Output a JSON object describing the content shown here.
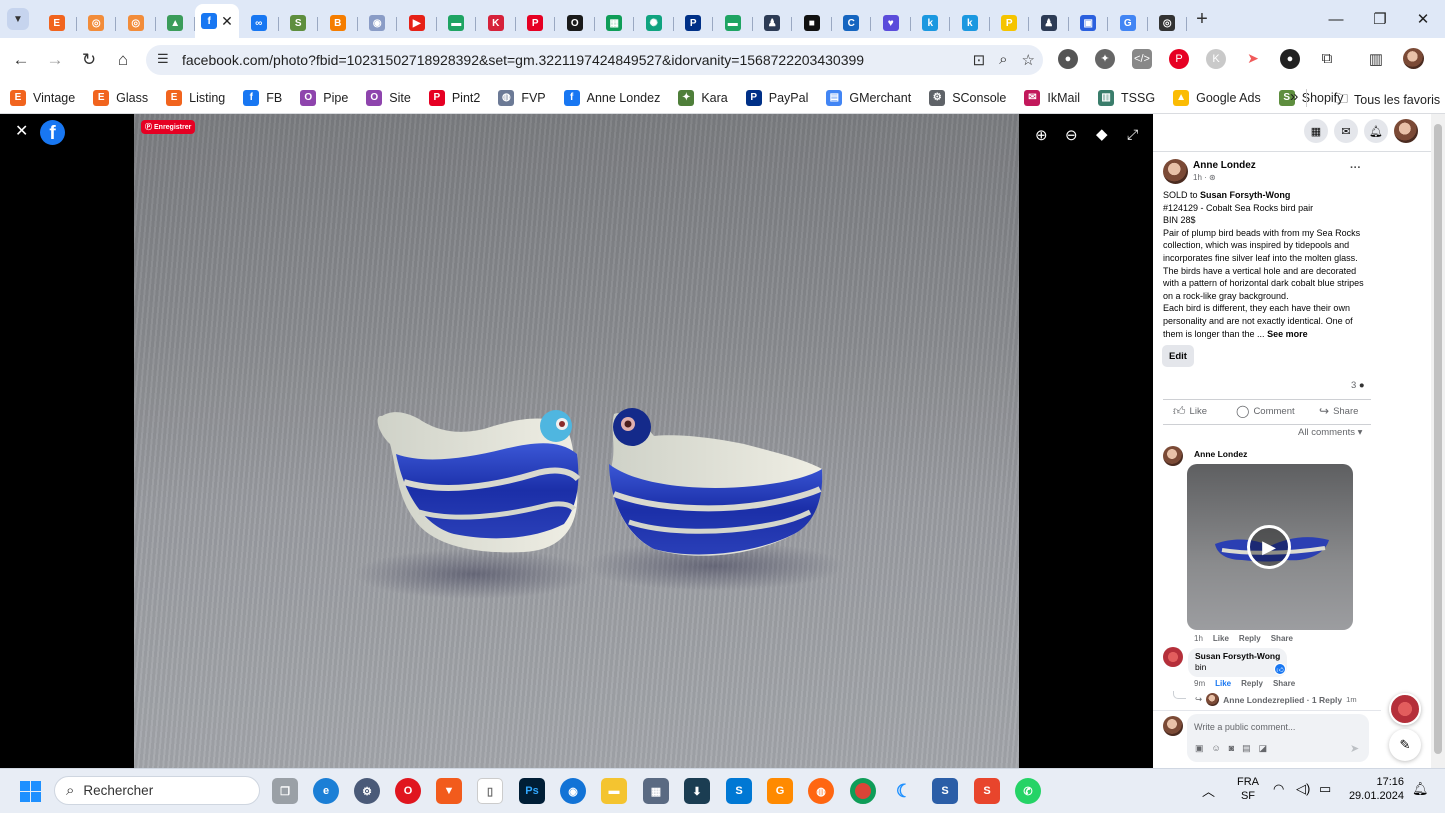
{
  "browser": {
    "url": "facebook.com/photo?fbid=10231502718928392&set=gm.3221197424849527&idorvanity=1568722203430399",
    "tab_close": "✕",
    "new_tab": "+",
    "tabs": [
      {
        "icon": "etsy-icon",
        "color": "#f1641e",
        "glyph": "E"
      },
      {
        "icon": "orange-circle-icon",
        "color": "#f28c3a",
        "glyph": "◎"
      },
      {
        "icon": "orange-circle-icon",
        "color": "#f28c3a",
        "glyph": "◎"
      },
      {
        "icon": "triangle-app-icon",
        "color": "#3b9c5a",
        "glyph": "▲"
      },
      {
        "icon": "facebook-icon",
        "color": "#1877f2",
        "glyph": "f"
      },
      {
        "icon": "meta-icon",
        "color": "#1877f2",
        "glyph": "∞"
      },
      {
        "icon": "shopify-icon",
        "color": "#5e8e3e",
        "glyph": "S"
      },
      {
        "icon": "blogger-icon",
        "color": "#f57d00",
        "glyph": "B"
      },
      {
        "icon": "gray-circle-icon",
        "color": "#8a9cc6",
        "glyph": "◉"
      },
      {
        "icon": "youtube-icon",
        "color": "#e62117",
        "glyph": "▶"
      },
      {
        "icon": "green-chat-icon",
        "color": "#1fa463",
        "glyph": "▬"
      },
      {
        "icon": "red-k-icon",
        "color": "#d6213a",
        "glyph": "K"
      },
      {
        "icon": "pinterest-icon",
        "color": "#e60023",
        "glyph": "P"
      },
      {
        "icon": "black-ring-icon",
        "color": "#1a1a1a",
        "glyph": "O"
      },
      {
        "icon": "green-grid-icon",
        "color": "#0f9d58",
        "glyph": "▦"
      },
      {
        "icon": "chatgpt-icon",
        "color": "#10a37f",
        "glyph": "✺"
      },
      {
        "icon": "paypal-icon",
        "color": "#003087",
        "glyph": "P"
      },
      {
        "icon": "green-chat-icon",
        "color": "#1fa463",
        "glyph": "▬"
      },
      {
        "icon": "person-icon",
        "color": "#2d3b55",
        "glyph": "♟"
      },
      {
        "icon": "black-box-icon",
        "color": "#111111",
        "glyph": "■"
      },
      {
        "icon": "blue-c-icon",
        "color": "#1565c0",
        "glyph": "C"
      },
      {
        "icon": "heart-icon",
        "color": "#5b4cdb",
        "glyph": "♥"
      },
      {
        "icon": "k-icon",
        "color": "#1b98e0",
        "glyph": "k"
      },
      {
        "icon": "k-icon",
        "color": "#1b98e0",
        "glyph": "k"
      },
      {
        "icon": "yellow-p-icon",
        "color": "#f5c400",
        "glyph": "P"
      },
      {
        "icon": "person-icon",
        "color": "#2d3b55",
        "glyph": "♟"
      },
      {
        "icon": "blue-box-icon",
        "color": "#2b60de",
        "glyph": "▣"
      },
      {
        "icon": "google-icon",
        "color": "#4285f4",
        "glyph": "G"
      },
      {
        "icon": "dark-circle-icon",
        "color": "#333333",
        "glyph": "◎"
      }
    ]
  },
  "bookmarks": [
    {
      "label": "Vintage",
      "icon": "etsy-icon",
      "color": "#f1641e",
      "glyph": "E"
    },
    {
      "label": "Glass",
      "icon": "etsy-icon",
      "color": "#f1641e",
      "glyph": "E"
    },
    {
      "label": "Listing",
      "icon": "etsy-icon",
      "color": "#f1641e",
      "glyph": "E"
    },
    {
      "label": "FB",
      "icon": "facebook-icon",
      "color": "#1877f2",
      "glyph": "f"
    },
    {
      "label": "Pipe",
      "icon": "purple-ring-icon",
      "color": "#8e44ad",
      "glyph": "O"
    },
    {
      "label": "Site",
      "icon": "purple-ring-icon",
      "color": "#8e44ad",
      "glyph": "O"
    },
    {
      "label": "Pint2",
      "icon": "pinterest-icon",
      "color": "#e60023",
      "glyph": "P"
    },
    {
      "label": "FVP",
      "icon": "fvp-icon",
      "color": "#6c7a96",
      "glyph": "◍"
    },
    {
      "label": "Anne Londez",
      "icon": "facebook-icon",
      "color": "#1877f2",
      "glyph": "f"
    },
    {
      "label": "Kara",
      "icon": "turtle-icon",
      "color": "#4f7f3a",
      "glyph": "✦"
    },
    {
      "label": "PayPal",
      "icon": "paypal-icon",
      "color": "#003087",
      "glyph": "P"
    },
    {
      "label": "GMerchant",
      "icon": "merchant-icon",
      "color": "#4285f4",
      "glyph": "▤"
    },
    {
      "label": "SConsole",
      "icon": "search-console-icon",
      "color": "#5f6368",
      "glyph": "⚙"
    },
    {
      "label": "IkMail",
      "icon": "mail-icon",
      "color": "#c2185b",
      "glyph": "✉"
    },
    {
      "label": "TSSG",
      "icon": "tssg-icon",
      "color": "#3a7d6b",
      "glyph": "▥"
    },
    {
      "label": "Google Ads",
      "icon": "google-ads-icon",
      "color": "#fbbc04",
      "glyph": "▲"
    },
    {
      "label": "Shopify",
      "icon": "shopify-icon",
      "color": "#5e8e3e",
      "glyph": "S"
    }
  ],
  "bookmarks_more": "»",
  "bookmarks_all": "Tous les favoris",
  "photo_viewer": {
    "close": "✕",
    "save_badge": "Enregistrer"
  },
  "post": {
    "author": "Anne Londez",
    "time": "1h · ",
    "more": "···",
    "line1_prefix": "SOLD to ",
    "line1_name": "Susan Forsyth-Wong",
    "line2": "#124129 - Cobalt Sea Rocks bird pair",
    "line3": "BIN 28$",
    "body1": "Pair of plump bird beads with from my Sea Rocks collection, which was inspired by tidepools and incorporates fine silver leaf into the molten glass. The birds have a vertical hole and are decorated with a pattern of horizontal dark cobalt blue stripes on a rock-like gray background.",
    "body2": "Each bird is different, they each have their own personality and are not exactly identical. One of them is longer than the ... ",
    "see_more": "See more",
    "edit": "Edit",
    "comment_count": "3",
    "like": "Like",
    "comment": "Comment",
    "share": "Share",
    "all_comments": "All comments"
  },
  "comments": [
    {
      "author": "Anne Londez",
      "time": "1h",
      "like": "Like",
      "reply": "Reply",
      "share": "Share"
    },
    {
      "author": "Susan Forsyth-Wong",
      "text": "bin",
      "time": "9m",
      "like": "Like",
      "reply": "Reply",
      "share": "Share"
    }
  ],
  "reply_summary": {
    "author": "Anne Londez",
    "text": " replied · 1 Reply",
    "time": "1m"
  },
  "composer": {
    "placeholder": "Write a public comment..."
  },
  "taskbar": {
    "search_placeholder": "Rechercher",
    "lang1": "FRA",
    "lang2": "SF",
    "time": "17:16",
    "date": "29.01.2024"
  }
}
